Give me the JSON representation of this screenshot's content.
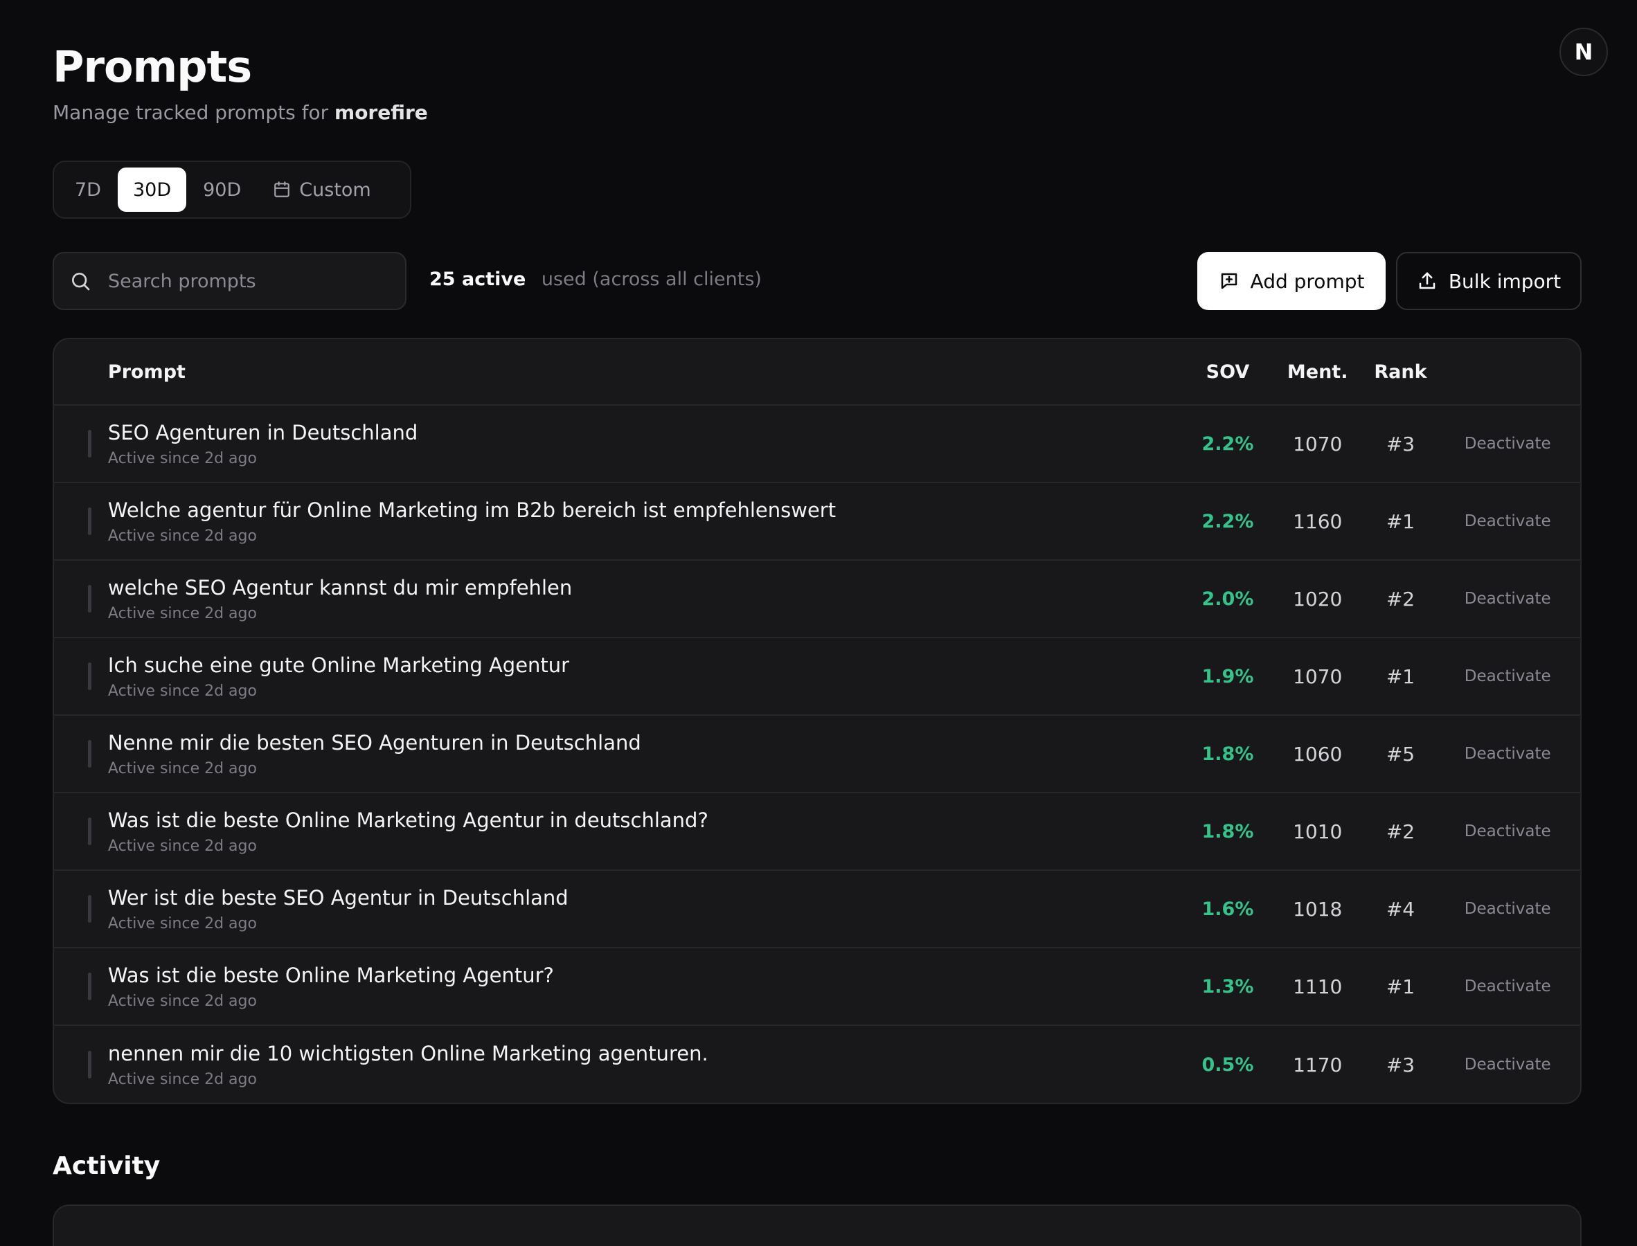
{
  "header": {
    "title": "Prompts",
    "subtitle_prefix": "Manage tracked prompts for",
    "client_name": "morefire",
    "avatar_letter": "N"
  },
  "range": {
    "options": [
      "7D",
      "30D",
      "90D",
      "Custom"
    ],
    "selected": "30D"
  },
  "search": {
    "placeholder": "Search prompts"
  },
  "usage": {
    "count_label": "25 active",
    "suffix": "used (across all clients)"
  },
  "actions": {
    "add_label": "Add prompt",
    "bulk_label": "Bulk import"
  },
  "table": {
    "columns": {
      "prompt": "Prompt",
      "sov": "SOV",
      "ment": "Ment.",
      "rank": "Rank"
    },
    "rows": [
      {
        "prompt": "SEO Agenturen in Deutschland",
        "since": "Active since 2d ago",
        "sov": "2.2%",
        "ment": "1070",
        "rank": "#3",
        "action": "Deactivate"
      },
      {
        "prompt": "Welche agentur für Online Marketing im B2b bereich ist empfehlenswert",
        "since": "Active since 2d ago",
        "sov": "2.2%",
        "ment": "1160",
        "rank": "#1",
        "action": "Deactivate"
      },
      {
        "prompt": "welche SEO Agentur kannst du mir empfehlen",
        "since": "Active since 2d ago",
        "sov": "2.0%",
        "ment": "1020",
        "rank": "#2",
        "action": "Deactivate"
      },
      {
        "prompt": "Ich suche eine gute Online Marketing Agentur",
        "since": "Active since 2d ago",
        "sov": "1.9%",
        "ment": "1070",
        "rank": "#1",
        "action": "Deactivate"
      },
      {
        "prompt": "Nenne mir die besten SEO Agenturen in Deutschland",
        "since": "Active since 2d ago",
        "sov": "1.8%",
        "ment": "1060",
        "rank": "#5",
        "action": "Deactivate"
      },
      {
        "prompt": "Was ist die beste Online Marketing Agentur in deutschland?",
        "since": "Active since 2d ago",
        "sov": "1.8%",
        "ment": "1010",
        "rank": "#2",
        "action": "Deactivate"
      },
      {
        "prompt": "Wer ist die beste SEO Agentur in Deutschland",
        "since": "Active since 2d ago",
        "sov": "1.6%",
        "ment": "1018",
        "rank": "#4",
        "action": "Deactivate"
      },
      {
        "prompt": "Was ist die beste Online Marketing Agentur?",
        "since": "Active since 2d ago",
        "sov": "1.3%",
        "ment": "1110",
        "rank": "#1",
        "action": "Deactivate"
      },
      {
        "prompt": "nennen mir die 10 wichtigsten Online Marketing agenturen.",
        "since": "Active since 2d ago",
        "sov": "0.5%",
        "ment": "1170",
        "rank": "#3",
        "action": "Deactivate"
      }
    ]
  },
  "activity": {
    "title": "Activity"
  },
  "icons": {
    "search": "search-icon",
    "calendar": "calendar-icon",
    "add": "message-plus-icon",
    "bulk": "upload-icon"
  },
  "colors": {
    "sov_positive": "#34c48b",
    "background": "#0b0b0d",
    "card": "#18181b"
  }
}
